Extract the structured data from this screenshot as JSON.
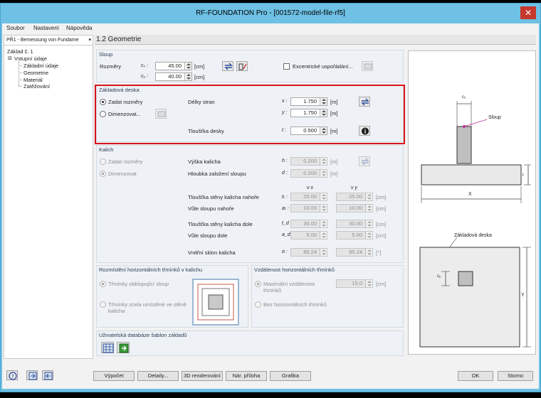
{
  "window": {
    "title": "RF-FOUNDATION Pro - [001572-model-file-rf5]",
    "close": "✕"
  },
  "menu": [
    "Soubor",
    "Nastavení",
    "Nápověda"
  ],
  "left": {
    "combo": "PŘ1 - Bemessung von Fundame",
    "tree_root": "Základ č. 1",
    "tree_group": "Vstupní údaje",
    "tree_items": [
      "Základní údaje",
      "Geometrie",
      "Materiál",
      "Zatěžování"
    ]
  },
  "page_title": "1.2 Geometrie",
  "sloup": {
    "title": "Sloup",
    "rozmery": "Rozměry",
    "cx_label": "cₓ :",
    "cy_label": "cᵧ :",
    "cx_value": "45.00",
    "cy_value": "40.00",
    "unit": "[cm]",
    "excentricke": "Excentrické uspořádání..."
  },
  "deska": {
    "title": "Základová deska",
    "zadat": "Zadat rozměry",
    "dimenzovat": "Dimenzovat...",
    "delky": "Délky stran",
    "x_label": "x :",
    "y_label": "y :",
    "x_value": "1.750",
    "y_value": "1.750",
    "tloustka": "Tloušťka desky",
    "t_label": "t :",
    "t_value": "0.500",
    "unit": "[m]"
  },
  "kalich": {
    "title": "Kalich",
    "zadat": "Zadat rozměry",
    "dimenzovat": "Dimenzovat",
    "vyska": "Výška kalicha",
    "h_label": "h :",
    "h_value": "0.200",
    "hloubka": "Hloubka založení sloupu",
    "d_label": "d :",
    "d_value": "0.200",
    "unit_m": "[m]",
    "col_vx": "v x",
    "col_vy": "v y",
    "steny_nahore": "Tloušťka stěny kalicha nahoře",
    "tt_label": "tₜ :",
    "tt_x": "25.00",
    "tt_y": "25.00",
    "vule_nahore": "Vůle sloupu nahoře",
    "at_label": "aₜ :",
    "at_x": "10.00",
    "at_y": "10.00",
    "steny_dole": "Tloušťka stěny kalicha dole",
    "tb_label": "t_d :",
    "tb_x": "30.00",
    "tb_y": "30.00",
    "vule_dole": "Vůle sloupu dole",
    "ab_label": "a_d :",
    "ab_x": "5.00",
    "ab_y": "5.00",
    "sklon": "Vnitřní sklon kalicha",
    "alpha_label": "α :",
    "alpha_x": "85.24",
    "alpha_y": "85.24",
    "unit_cm": "[cm]",
    "unit_deg": "[°]"
  },
  "rozmisteni": {
    "title": "Rozmístění horizontálních třmínků v kalichu",
    "opt1": "Třmínky obklopující sloup",
    "opt2a": "Třmínky zcela umístěné ve stěně",
    "opt2b": "kalicha"
  },
  "vzdalenost": {
    "title": "Vzdálenost horizontálních třmínků",
    "opt1a": "Maximální vzdálenost",
    "opt1b": "třmínků",
    "value": "15.0",
    "unit": "[cm]",
    "opt2": "Bez horizontálních třmínků"
  },
  "databaze": {
    "title": "Uživatelská databáze šablon základů"
  },
  "preview": {
    "sloup": "Sloup",
    "deska": "Základová deska",
    "cx": "cₓ",
    "cy": "cᵧ",
    "t": "t",
    "x": "X",
    "y": "Y"
  },
  "buttons": {
    "vypocet": "Výpočet",
    "detaily": "Detaily...",
    "render": "3D renderování",
    "priloha": "Nár. příloha",
    "grafika": "Grafika",
    "ok": "OK",
    "storno": "Storno"
  }
}
